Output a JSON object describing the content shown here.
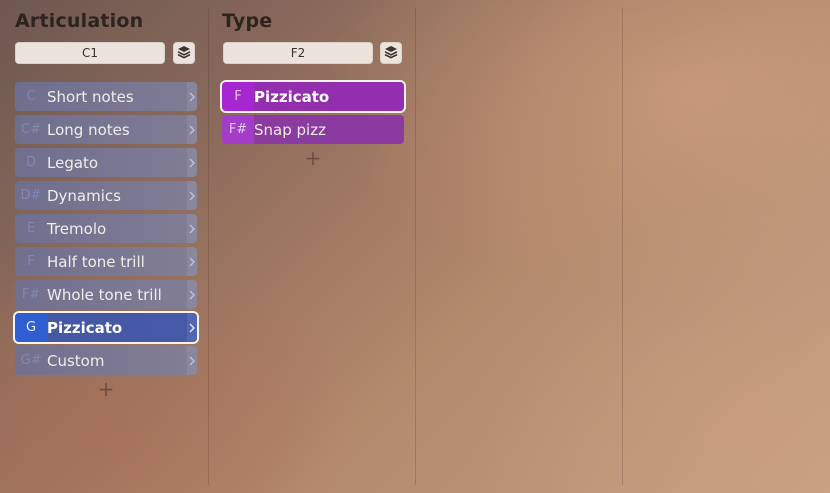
{
  "columns": [
    {
      "title": "Articulation",
      "key": "C1",
      "items": [
        {
          "key": "C",
          "label": "Short notes"
        },
        {
          "key": "C#",
          "label": "Long notes"
        },
        {
          "key": "D",
          "label": "Legato"
        },
        {
          "key": "D#",
          "label": "Dynamics"
        },
        {
          "key": "E",
          "label": "Tremolo"
        },
        {
          "key": "F",
          "label": "Half tone trill"
        },
        {
          "key": "F#",
          "label": "Whole tone trill"
        },
        {
          "key": "G",
          "label": "Pizzicato"
        },
        {
          "key": "G#",
          "label": "Custom"
        }
      ],
      "selected_index": 7,
      "add_label": "+"
    },
    {
      "title": "Type",
      "key": "F2",
      "items": [
        {
          "key": "F",
          "label": "Pizzicato"
        },
        {
          "key": "F#",
          "label": "Snap pizz"
        }
      ],
      "selected_index": 0,
      "add_label": "+"
    }
  ],
  "icons": {
    "layers": "layers-icon",
    "chevron": "chevron-right-icon",
    "add": "plus-icon"
  },
  "colors": {
    "articulation_item": "#737599",
    "articulation_selected": "#3a5cc8",
    "type_item": "#8d3aa2",
    "type_selected_key": "#a626d0"
  }
}
